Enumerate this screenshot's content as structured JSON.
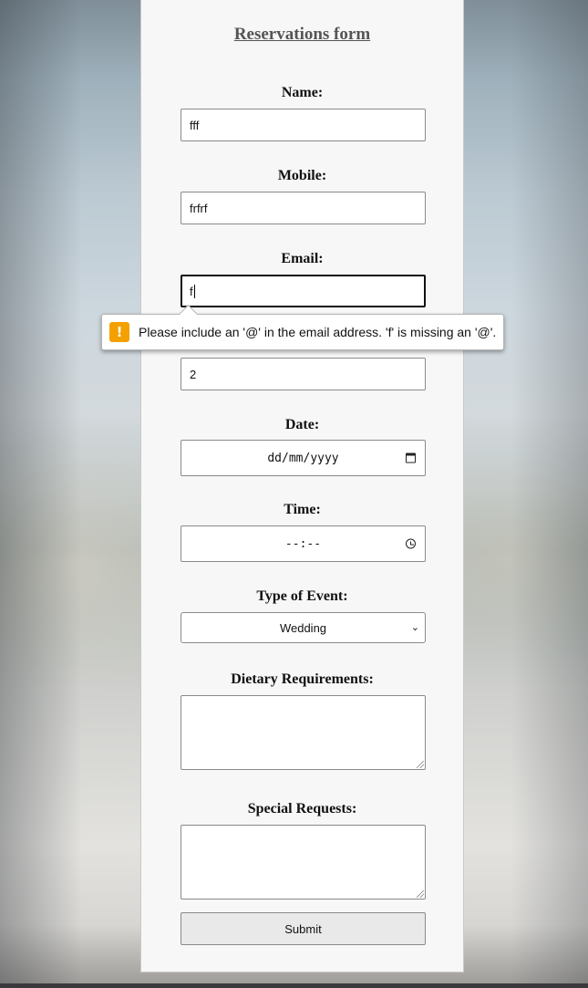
{
  "form": {
    "title": "Reservations form",
    "name": {
      "label": "Name:",
      "value": "fff"
    },
    "mobile": {
      "label": "Mobile:",
      "value": "frfrf"
    },
    "email": {
      "label": "Email:",
      "value": "f"
    },
    "guests": {
      "value": "2"
    },
    "date": {
      "label": "Date:",
      "placeholder": "dd/mm/yyyy"
    },
    "time": {
      "label": "Time:",
      "placeholder": "--:--"
    },
    "event_type": {
      "label": "Type of Event:",
      "selected": "Wedding"
    },
    "dietary": {
      "label": "Dietary Requirements:",
      "value": ""
    },
    "special_requests": {
      "label": "Special Requests:",
      "value": ""
    },
    "submit_label": "Submit"
  },
  "validation": {
    "message": "Please include an '@' in the email address. 'f' is missing an '@'.",
    "icon": "warning-icon",
    "icon_glyph": "!",
    "icon_color": "#f4a000"
  },
  "icons": {
    "calendar": "calendar-icon",
    "clock": "clock-icon",
    "select_chevron": "⌄"
  }
}
